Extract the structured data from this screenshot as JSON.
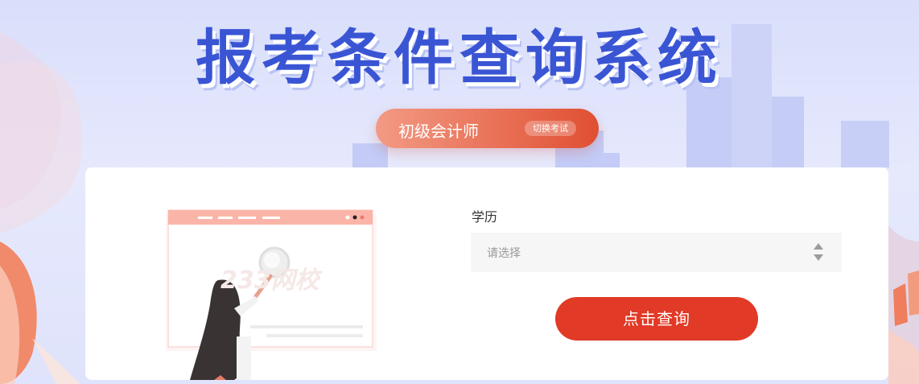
{
  "header": {
    "title": "报考条件查询系统"
  },
  "exam_selector": {
    "exam_name": "初级会计师",
    "switch_label": "切换考试"
  },
  "form": {
    "education_label": "学历",
    "education_select": {
      "placeholder": "请选择",
      "selected": ""
    },
    "submit_label": "点击查询"
  },
  "illustration": {
    "watermark": "233网校"
  },
  "colors": {
    "accent": "#e13a26",
    "title_blue": "#3a55d4",
    "background": "#dfe3fb",
    "pill_start": "#f39a84",
    "pill_end": "#e04f32"
  },
  "icons": {
    "select_arrows": "sort-arrows-icon"
  }
}
